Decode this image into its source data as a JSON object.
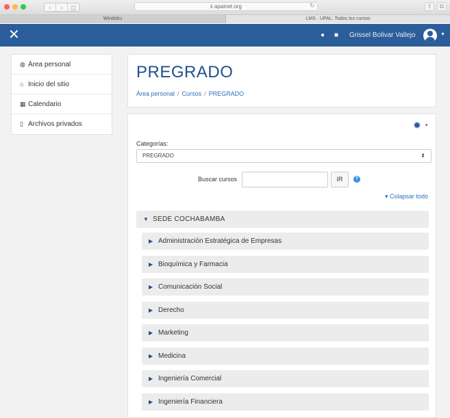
{
  "browser": {
    "url": "ii apainet.org",
    "nav_back": "‹",
    "nav_forward": "›",
    "nav_sidebar": "◫",
    "reload": "↻",
    "tabs": [
      "Windoku",
      "LMS · UPAL: Todos los cursos"
    ],
    "share_icon": "share-icon",
    "tabs_icon": "tabs-icon"
  },
  "navbar": {
    "close_label": "✕",
    "bell_icon": "🔔",
    "chat_icon": "💬",
    "username": "Grissel Bolivar Vallejo",
    "caret": "▼",
    "bg_color": "#2a5d9a"
  },
  "sidebar": {
    "items": [
      {
        "icon": "dashboard-icon",
        "glyph": "◍",
        "label": "Área personal"
      },
      {
        "icon": "home-icon",
        "glyph": "⌂",
        "label": "Inicio del sitio"
      },
      {
        "icon": "calendar-icon",
        "glyph": "▦",
        "label": "Calendario"
      },
      {
        "icon": "file-icon",
        "glyph": "▯",
        "label": "Archivos privados"
      }
    ]
  },
  "header": {
    "title": "PREGRADO",
    "breadcrumb": [
      "Área personal",
      "Cursos",
      "PREGRADO"
    ],
    "separator": "/"
  },
  "content": {
    "gear_glyph": "✹",
    "gear_caret": "▾",
    "categories_label": "Categorías:",
    "selected_category": "PREGRADO",
    "select_arrow": "⬍",
    "search_label": "Buscar cursos",
    "search_value": "",
    "search_button": "IR",
    "help_glyph": "?",
    "collapse_all": "▾ Colapsar todo",
    "campus": "SEDE COCHABAMBA",
    "campus_toggle": "▼",
    "course_toggle": "▶",
    "courses": [
      "Administración Estratégica de Empresas",
      "Bioquímica y Farmacia",
      "Comunicación Social",
      "Derecho",
      "Marketing",
      "Medicina",
      "Ingeniería Comercial",
      "Ingeniería Financiera"
    ]
  }
}
